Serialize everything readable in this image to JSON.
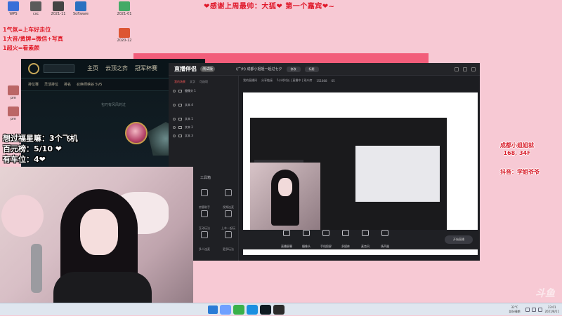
{
  "banner": "❤感谢上周最帅：大狐❤    第一个嘉宾❤~",
  "desktop_icons": [
    {
      "label": "WPS",
      "color": "#3a6fd8"
    },
    {
      "label": "cxc",
      "color": "#5b5b5b"
    },
    {
      "label": "2021-11",
      "color": "#444"
    },
    {
      "label": "Software",
      "color": "#2a70c0"
    },
    {
      "label": "2021-01",
      "color": "#4a6"
    },
    {
      "label": "2020-12",
      "color": "#d53"
    },
    {
      "label": "pm",
      "color": "#b66"
    },
    {
      "label": "pm",
      "color": "#b66"
    }
  ],
  "left_overlay": [
    "1气氛=上车好走位",
    "1大音/黄牌=微信+写真",
    "1超火=看素颜"
  ],
  "stream_counters": [
    "想过福星嘛：3个飞机",
    "百元榜：5/10 ❤",
    "有车位：4❤"
  ],
  "side_info": {
    "line1": "成都小姐姐就",
    "line2": "168, 34F",
    "douyin": "抖音：学姐爷爷"
  },
  "game": {
    "nav": [
      "主页",
      "云顶之弈",
      "冠军杯赛"
    ],
    "sub": [
      "排位赛",
      "灵活排位",
      "排名",
      "召唤师峡谷 5V5"
    ],
    "chat_label": "包巧有风风的过"
  },
  "obs": {
    "title": "直播伴侣",
    "badge": "测试版",
    "room": "(广州) 成都小姐姐一起过七夕",
    "pill1": "修改",
    "pill2": "标题",
    "tabs": [
      "我的场景",
      "文字",
      "可选项"
    ],
    "scenes": [
      "摄像头 1",
      "文本 4",
      "文本 1",
      "文本 2",
      "文本 3"
    ],
    "tools_label": "工具箱",
    "tools": [
      "房管助手",
      "视频连麦",
      "互动玩法",
      "上车一起玩",
      "多人连麦",
      "更多玩法"
    ],
    "room_info": [
      "我的直播间",
      "分享链接",
      "5小时时长 | 直播中 | 观众席",
      "151868",
      "65"
    ],
    "toolbar": [
      "直播屏幕",
      "摄像头",
      "手机投屏",
      "多媒体",
      "麦克风",
      "扬声器"
    ],
    "live_button": "开始直播"
  },
  "taskbar": {
    "apps": [
      {
        "name": "start-button",
        "color": "#2a7bd6"
      },
      {
        "name": "app-k",
        "color": "#6fa0ff"
      },
      {
        "name": "app-player",
        "color": "#3ab14a"
      },
      {
        "name": "app-tools",
        "color": "#1b8fe0"
      },
      {
        "name": "app-league",
        "color": "#0f1a22"
      },
      {
        "name": "app-obs",
        "color": "#2b2b2b"
      }
    ],
    "weather": "32°C",
    "weather_sub": "部分晴朗",
    "time": "23:01",
    "date": "2021/8/11"
  },
  "watermark": "斗鱼"
}
